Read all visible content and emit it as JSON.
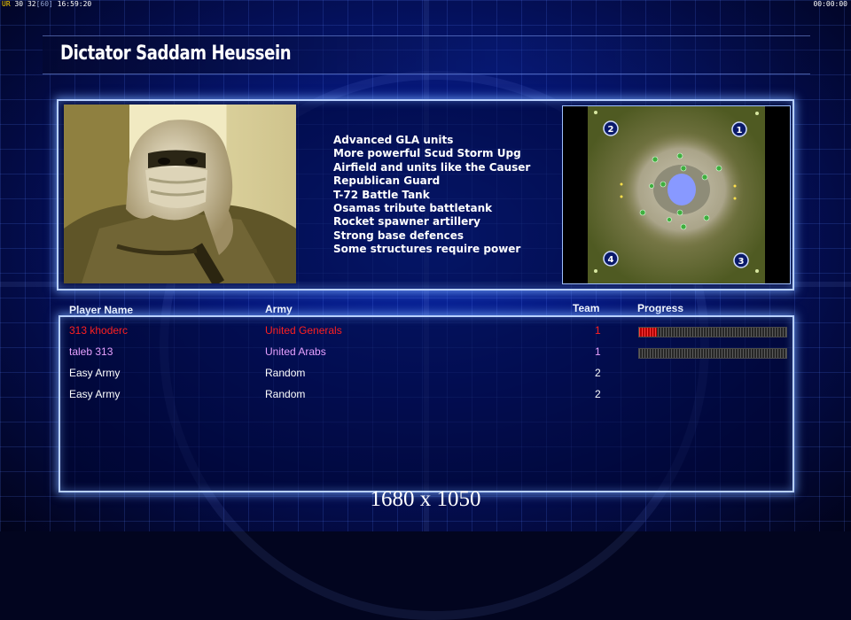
{
  "status_bar": {
    "left_tag": "UR",
    "left_a": "30",
    "left_b": "32",
    "left_c": "[60]",
    "clock": "16:59:20",
    "timer": "00:00:00"
  },
  "general": {
    "title": "Dictator Saddam Heussein",
    "features": [
      "Advanced GLA units",
      "More powerful Scud Storm Upg",
      "Airfield and units like the Causer",
      "Republican Guard",
      "T-72 Battle Tank",
      "Osamas tribute battletank",
      "Rocket spawner artillery",
      "Strong base defences",
      "Some structures require power"
    ]
  },
  "minimap": {
    "start_positions": [
      "1",
      "2",
      "3",
      "4"
    ]
  },
  "players_table": {
    "columns": {
      "name": "Player Name",
      "army": "Army",
      "team": "Team",
      "progress": "Progress"
    },
    "rows": [
      {
        "name": "313 khoderc",
        "army": "United Generals",
        "team": "1",
        "color": "#ff2020",
        "progress": 0.12
      },
      {
        "name": "taleb 313",
        "army": "United Arabs",
        "team": "1",
        "color": "#e6a0ff",
        "progress": 0.0
      },
      {
        "name": "Easy Army",
        "army": "Random",
        "team": "2",
        "color": "#ffffff",
        "progress": null
      },
      {
        "name": "Easy Army",
        "army": "Random",
        "team": "2",
        "color": "#ffffff",
        "progress": null
      }
    ]
  },
  "footer": {
    "resolution": "1680 x 1050"
  },
  "colors": {
    "frame_glow": "#b8d0ff",
    "background": "#06187a"
  }
}
